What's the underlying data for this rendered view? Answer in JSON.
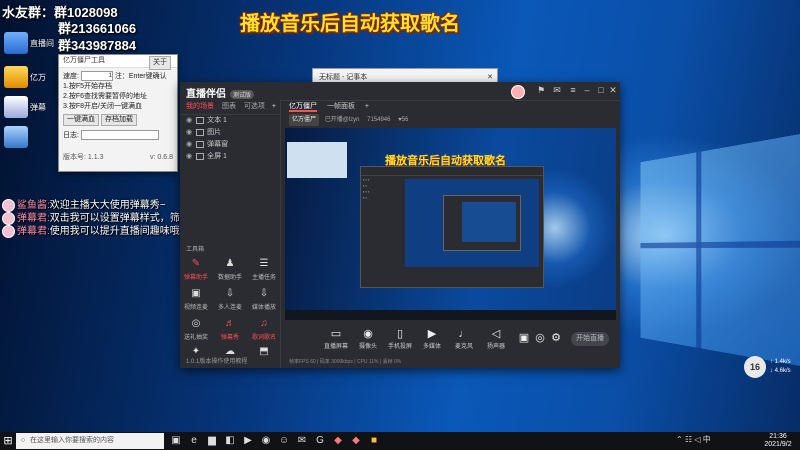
{
  "overlay": {
    "title_banner": "播放音乐后自动获取歌名",
    "group_line1": "水友群：群",
    "group_num1": "1028098",
    "group_line2": "群213661066",
    "group_line3": "群343987884"
  },
  "desktop_icons": [
    {
      "label": "直播间"
    },
    {
      "label": "亿万"
    },
    {
      "label": "弹幕"
    }
  ],
  "tool_window": {
    "title": "亿万僵尸工具",
    "close_label": "关于",
    "speed_label": "速度:",
    "speed_value": "1",
    "speed_note": "注：Enter键确认",
    "lines": [
      "1.按F5开始存档",
      "2.按F6查找需要暂停的地址",
      "3.按F8开启/关闭一键满血"
    ],
    "btn_a": "一键满血",
    "btn_b": "存档加载",
    "log_label": "日志:",
    "footer_left": "版本号: 1.1.3",
    "footer_right": "v: 0.6.8"
  },
  "chat": [
    {
      "nick": "鲨鱼酱:",
      "text": "欢迎主播大大使用弹幕秀~"
    },
    {
      "nick": "弹幕君:",
      "text": "双击我可以设置弹幕样式，筛选展示哦~"
    },
    {
      "nick": "弹幕君:",
      "text": "使用我可以提升直播间趣味哦(#^0^#)"
    }
  ],
  "back_window": {
    "title": "无标题 - 记事本"
  },
  "app": {
    "logo": "直播伴侣",
    "version": "测试版",
    "left_tabs": [
      "我的场景",
      "图表",
      "可选项"
    ],
    "scenes": [
      "文本 1",
      "图片",
      "弹幕窗",
      "全屏 1"
    ],
    "tools_head": "工具箱",
    "tools": [
      {
        "label": "弹幕助手",
        "icon": "✎"
      },
      {
        "label": "数据助手",
        "icon": "♟"
      },
      {
        "label": "主播任务",
        "icon": "☰"
      },
      {
        "label": "视频连麦",
        "icon": "▣"
      },
      {
        "label": "多人连麦",
        "icon": "⇩"
      },
      {
        "label": "媒体播放",
        "icon": "⇩"
      },
      {
        "label": "送礼抽奖",
        "icon": "◎"
      },
      {
        "label": "弹幕秀",
        "icon": "♬"
      },
      {
        "label": "歌词歌名",
        "icon": "♫"
      },
      {
        "label": "PK",
        "icon": "✦"
      },
      {
        "label": "互动",
        "icon": "☁"
      },
      {
        "label": "更多",
        "icon": "⬒"
      }
    ],
    "footer": "1.0.1版本操作使用教程",
    "scene_tabs": [
      "亿万僵尸",
      "一帧面板",
      "+"
    ],
    "scene_bar": {
      "chip": "亿万僵尸",
      "info1": "已开播@lzyn",
      "info2": "7154946",
      "info3": "56"
    },
    "preview_title": "播放音乐后自动获取歌名",
    "controls": [
      {
        "label": "直播屏幕",
        "icon": "▭"
      },
      {
        "label": "摄像头",
        "icon": "◉"
      },
      {
        "label": "手机投屏",
        "icon": "▯"
      },
      {
        "label": "多媒体",
        "icon": "▶"
      },
      {
        "label": "麦克风",
        "icon": "♩"
      },
      {
        "label": "扬声器",
        "icon": "◁"
      }
    ],
    "start_live": "开始直播",
    "status": "帧率FPS 60  |  码率 3000kbps  |  CPU 11%  |  丢帧 0%"
  },
  "right_badge": {
    "value": "16",
    "up": "1.4k/s",
    "down": "4.6k/s"
  },
  "taskbar": {
    "search_placeholder": "在这里输入你要搜索的内容",
    "time": "21:36",
    "date": "2021/9/2",
    "lang": "中"
  }
}
